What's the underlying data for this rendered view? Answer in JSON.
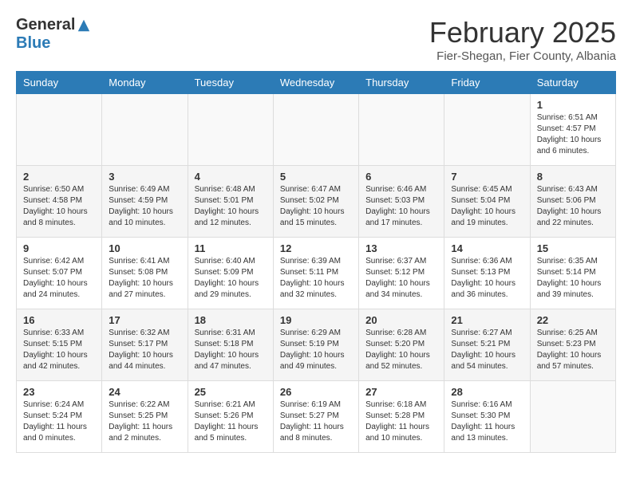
{
  "logo": {
    "general": "General",
    "blue": "Blue"
  },
  "title": "February 2025",
  "location": "Fier-Shegan, Fier County, Albania",
  "days_of_week": [
    "Sunday",
    "Monday",
    "Tuesday",
    "Wednesday",
    "Thursday",
    "Friday",
    "Saturday"
  ],
  "weeks": [
    [
      {
        "day": "",
        "info": ""
      },
      {
        "day": "",
        "info": ""
      },
      {
        "day": "",
        "info": ""
      },
      {
        "day": "",
        "info": ""
      },
      {
        "day": "",
        "info": ""
      },
      {
        "day": "",
        "info": ""
      },
      {
        "day": "1",
        "info": "Sunrise: 6:51 AM\nSunset: 4:57 PM\nDaylight: 10 hours and 6 minutes."
      }
    ],
    [
      {
        "day": "2",
        "info": "Sunrise: 6:50 AM\nSunset: 4:58 PM\nDaylight: 10 hours and 8 minutes."
      },
      {
        "day": "3",
        "info": "Sunrise: 6:49 AM\nSunset: 4:59 PM\nDaylight: 10 hours and 10 minutes."
      },
      {
        "day": "4",
        "info": "Sunrise: 6:48 AM\nSunset: 5:01 PM\nDaylight: 10 hours and 12 minutes."
      },
      {
        "day": "5",
        "info": "Sunrise: 6:47 AM\nSunset: 5:02 PM\nDaylight: 10 hours and 15 minutes."
      },
      {
        "day": "6",
        "info": "Sunrise: 6:46 AM\nSunset: 5:03 PM\nDaylight: 10 hours and 17 minutes."
      },
      {
        "day": "7",
        "info": "Sunrise: 6:45 AM\nSunset: 5:04 PM\nDaylight: 10 hours and 19 minutes."
      },
      {
        "day": "8",
        "info": "Sunrise: 6:43 AM\nSunset: 5:06 PM\nDaylight: 10 hours and 22 minutes."
      }
    ],
    [
      {
        "day": "9",
        "info": "Sunrise: 6:42 AM\nSunset: 5:07 PM\nDaylight: 10 hours and 24 minutes."
      },
      {
        "day": "10",
        "info": "Sunrise: 6:41 AM\nSunset: 5:08 PM\nDaylight: 10 hours and 27 minutes."
      },
      {
        "day": "11",
        "info": "Sunrise: 6:40 AM\nSunset: 5:09 PM\nDaylight: 10 hours and 29 minutes."
      },
      {
        "day": "12",
        "info": "Sunrise: 6:39 AM\nSunset: 5:11 PM\nDaylight: 10 hours and 32 minutes."
      },
      {
        "day": "13",
        "info": "Sunrise: 6:37 AM\nSunset: 5:12 PM\nDaylight: 10 hours and 34 minutes."
      },
      {
        "day": "14",
        "info": "Sunrise: 6:36 AM\nSunset: 5:13 PM\nDaylight: 10 hours and 36 minutes."
      },
      {
        "day": "15",
        "info": "Sunrise: 6:35 AM\nSunset: 5:14 PM\nDaylight: 10 hours and 39 minutes."
      }
    ],
    [
      {
        "day": "16",
        "info": "Sunrise: 6:33 AM\nSunset: 5:15 PM\nDaylight: 10 hours and 42 minutes."
      },
      {
        "day": "17",
        "info": "Sunrise: 6:32 AM\nSunset: 5:17 PM\nDaylight: 10 hours and 44 minutes."
      },
      {
        "day": "18",
        "info": "Sunrise: 6:31 AM\nSunset: 5:18 PM\nDaylight: 10 hours and 47 minutes."
      },
      {
        "day": "19",
        "info": "Sunrise: 6:29 AM\nSunset: 5:19 PM\nDaylight: 10 hours and 49 minutes."
      },
      {
        "day": "20",
        "info": "Sunrise: 6:28 AM\nSunset: 5:20 PM\nDaylight: 10 hours and 52 minutes."
      },
      {
        "day": "21",
        "info": "Sunrise: 6:27 AM\nSunset: 5:21 PM\nDaylight: 10 hours and 54 minutes."
      },
      {
        "day": "22",
        "info": "Sunrise: 6:25 AM\nSunset: 5:23 PM\nDaylight: 10 hours and 57 minutes."
      }
    ],
    [
      {
        "day": "23",
        "info": "Sunrise: 6:24 AM\nSunset: 5:24 PM\nDaylight: 11 hours and 0 minutes."
      },
      {
        "day": "24",
        "info": "Sunrise: 6:22 AM\nSunset: 5:25 PM\nDaylight: 11 hours and 2 minutes."
      },
      {
        "day": "25",
        "info": "Sunrise: 6:21 AM\nSunset: 5:26 PM\nDaylight: 11 hours and 5 minutes."
      },
      {
        "day": "26",
        "info": "Sunrise: 6:19 AM\nSunset: 5:27 PM\nDaylight: 11 hours and 8 minutes."
      },
      {
        "day": "27",
        "info": "Sunrise: 6:18 AM\nSunset: 5:28 PM\nDaylight: 11 hours and 10 minutes."
      },
      {
        "day": "28",
        "info": "Sunrise: 6:16 AM\nSunset: 5:30 PM\nDaylight: 11 hours and 13 minutes."
      },
      {
        "day": "",
        "info": ""
      }
    ]
  ]
}
